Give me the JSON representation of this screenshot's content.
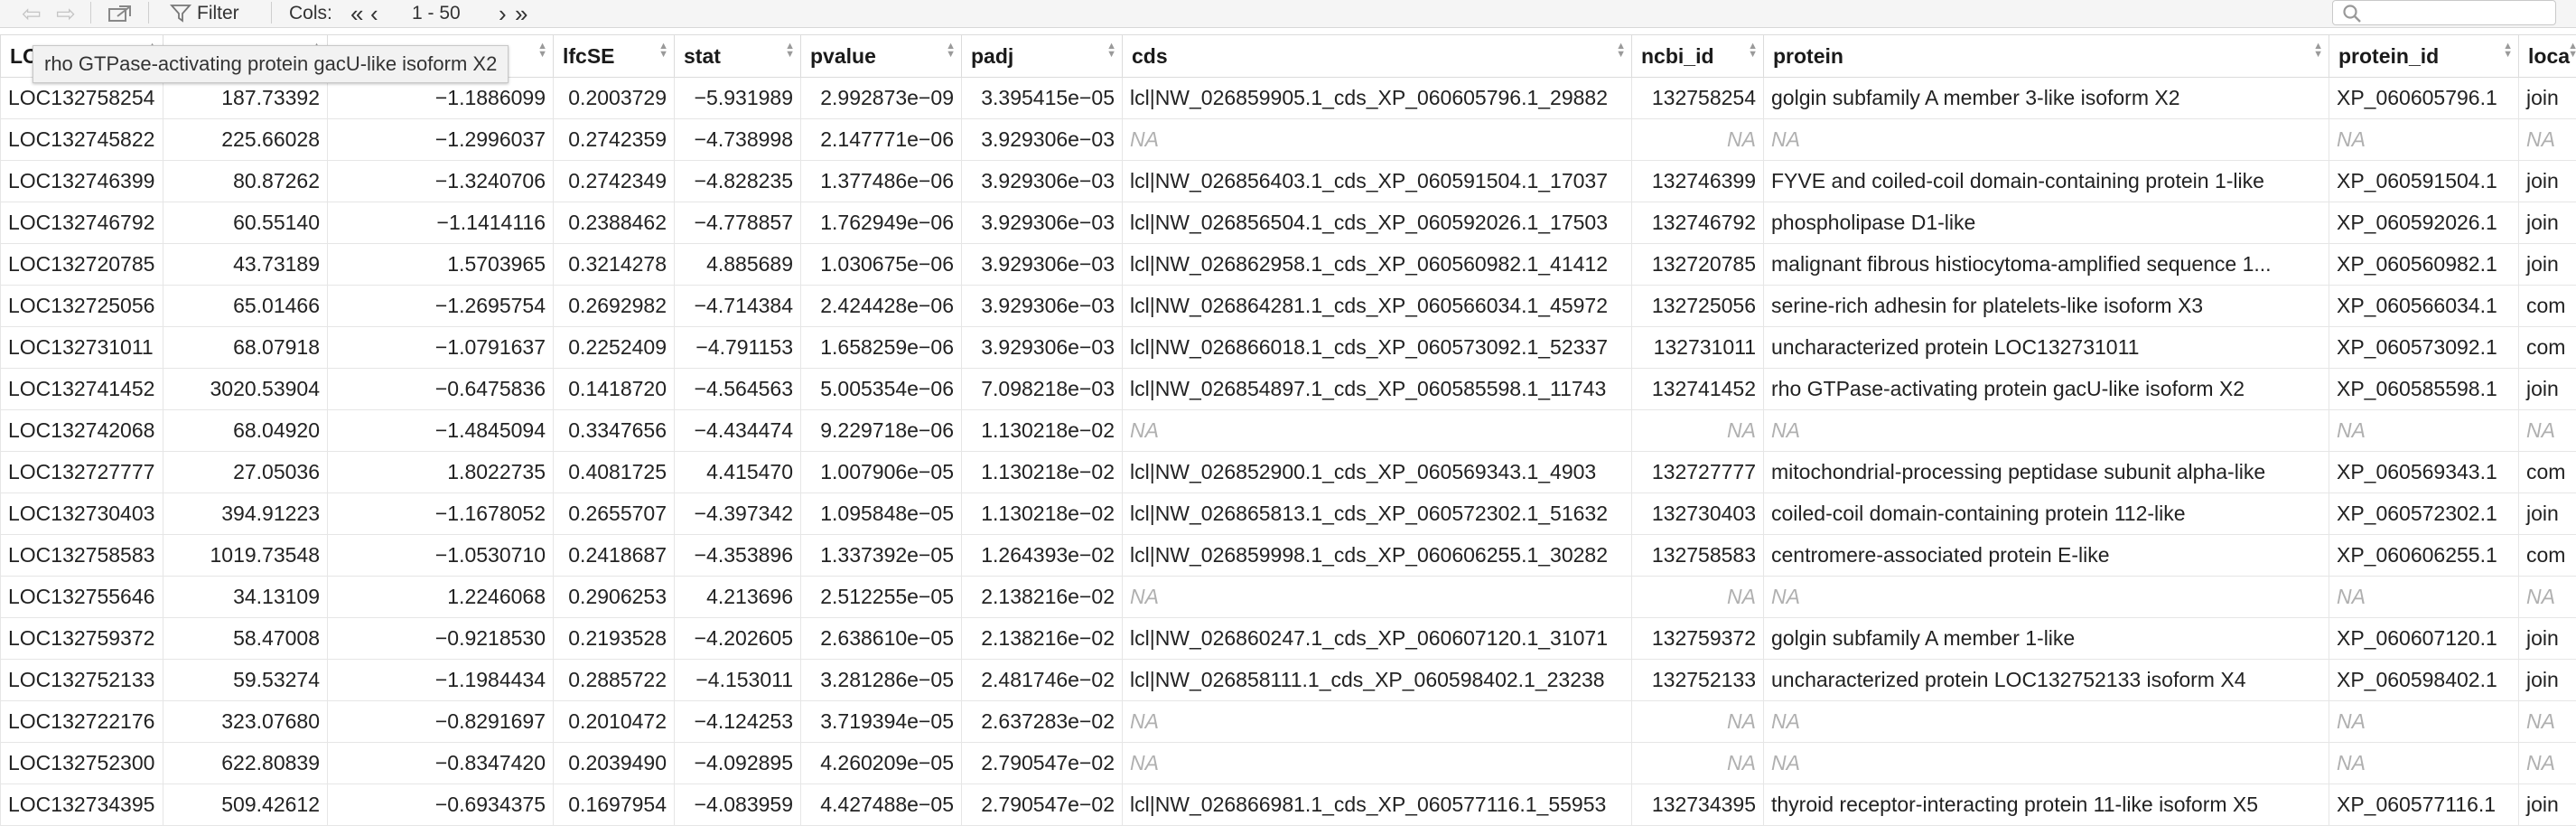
{
  "toolbar": {
    "filter_label": "Filter",
    "cols_label": "Cols:",
    "cols_first": "«",
    "cols_prev": "‹",
    "cols_range": "1 - 50",
    "cols_next": "›",
    "cols_last": "»",
    "search_placeholder": ""
  },
  "tooltip": "rho GTPase-activating protein gacU-like isoform X2",
  "columns": [
    "LO",
    "",
    "",
    "lfcSE",
    "stat",
    "pvalue",
    "padj",
    "cds",
    "ncbi_id",
    "protein",
    "protein_id",
    "loca"
  ],
  "rows": [
    [
      "LOC132758254",
      "187.73392",
      "−1.1886099",
      "0.2003729",
      "−5.931989",
      "2.992873e−09",
      "3.395415e−05",
      "lcl|NW_026859905.1_cds_XP_060605796.1_29882",
      "132758254",
      "golgin subfamily A member 3-like isoform X2",
      "XP_060605796.1",
      "join"
    ],
    [
      "LOC132745822",
      "225.66028",
      "−1.2996037",
      "0.2742359",
      "−4.738998",
      "2.147771e−06",
      "3.929306e−03",
      "NA",
      "NA",
      "NA",
      "NA",
      "NA"
    ],
    [
      "LOC132746399",
      "80.87262",
      "−1.3240706",
      "0.2742349",
      "−4.828235",
      "1.377486e−06",
      "3.929306e−03",
      "lcl|NW_026856403.1_cds_XP_060591504.1_17037",
      "132746399",
      "FYVE and coiled-coil domain-containing protein 1-like",
      "XP_060591504.1",
      "join"
    ],
    [
      "LOC132746792",
      "60.55140",
      "−1.1414116",
      "0.2388462",
      "−4.778857",
      "1.762949e−06",
      "3.929306e−03",
      "lcl|NW_026856504.1_cds_XP_060592026.1_17503",
      "132746792",
      "phospholipase D1-like",
      "XP_060592026.1",
      "join"
    ],
    [
      "LOC132720785",
      "43.73189",
      "1.5703965",
      "0.3214278",
      "4.885689",
      "1.030675e−06",
      "3.929306e−03",
      "lcl|NW_026862958.1_cds_XP_060560982.1_41412",
      "132720785",
      "malignant fibrous histiocytoma-amplified sequence 1...",
      "XP_060560982.1",
      "join"
    ],
    [
      "LOC132725056",
      "65.01466",
      "−1.2695754",
      "0.2692982",
      "−4.714384",
      "2.424428e−06",
      "3.929306e−03",
      "lcl|NW_026864281.1_cds_XP_060566034.1_45972",
      "132725056",
      "serine-rich adhesin for platelets-like isoform X3",
      "XP_060566034.1",
      "com"
    ],
    [
      "LOC132731011",
      "68.07918",
      "−1.0791637",
      "0.2252409",
      "−4.791153",
      "1.658259e−06",
      "3.929306e−03",
      "lcl|NW_026866018.1_cds_XP_060573092.1_52337",
      "132731011",
      "uncharacterized protein LOC132731011",
      "XP_060573092.1",
      "com"
    ],
    [
      "LOC132741452",
      "3020.53904",
      "−0.6475836",
      "0.1418720",
      "−4.564563",
      "5.005354e−06",
      "7.098218e−03",
      "lcl|NW_026854897.1_cds_XP_060585598.1_11743",
      "132741452",
      "rho GTPase-activating protein gacU-like isoform X2",
      "XP_060585598.1",
      "join"
    ],
    [
      "LOC132742068",
      "68.04920",
      "−1.4845094",
      "0.3347656",
      "−4.434474",
      "9.229718e−06",
      "1.130218e−02",
      "NA",
      "NA",
      "NA",
      "NA",
      "NA"
    ],
    [
      "LOC132727777",
      "27.05036",
      "1.8022735",
      "0.4081725",
      "4.415470",
      "1.007906e−05",
      "1.130218e−02",
      "lcl|NW_026852900.1_cds_XP_060569343.1_4903",
      "132727777",
      "mitochondrial-processing peptidase subunit alpha-like",
      "XP_060569343.1",
      "com"
    ],
    [
      "LOC132730403",
      "394.91223",
      "−1.1678052",
      "0.2655707",
      "−4.397342",
      "1.095848e−05",
      "1.130218e−02",
      "lcl|NW_026865813.1_cds_XP_060572302.1_51632",
      "132730403",
      "coiled-coil domain-containing protein 112-like",
      "XP_060572302.1",
      "join"
    ],
    [
      "LOC132758583",
      "1019.73548",
      "−1.0530710",
      "0.2418687",
      "−4.353896",
      "1.337392e−05",
      "1.264393e−02",
      "lcl|NW_026859998.1_cds_XP_060606255.1_30282",
      "132758583",
      "centromere-associated protein E-like",
      "XP_060606255.1",
      "com"
    ],
    [
      "LOC132755646",
      "34.13109",
      "1.2246068",
      "0.2906253",
      "4.213696",
      "2.512255e−05",
      "2.138216e−02",
      "NA",
      "NA",
      "NA",
      "NA",
      "NA"
    ],
    [
      "LOC132759372",
      "58.47008",
      "−0.9218530",
      "0.2193528",
      "−4.202605",
      "2.638610e−05",
      "2.138216e−02",
      "lcl|NW_026860247.1_cds_XP_060607120.1_31071",
      "132759372",
      "golgin subfamily A member 1-like",
      "XP_060607120.1",
      "join"
    ],
    [
      "LOC132752133",
      "59.53274",
      "−1.1984434",
      "0.2885722",
      "−4.153011",
      "3.281286e−05",
      "2.481746e−02",
      "lcl|NW_026858111.1_cds_XP_060598402.1_23238",
      "132752133",
      "uncharacterized protein LOC132752133 isoform X4",
      "XP_060598402.1",
      "join"
    ],
    [
      "LOC132722176",
      "323.07680",
      "−0.8291697",
      "0.2010472",
      "−4.124253",
      "3.719394e−05",
      "2.637283e−02",
      "NA",
      "NA",
      "NA",
      "NA",
      "NA"
    ],
    [
      "LOC132752300",
      "622.80839",
      "−0.8347420",
      "0.2039490",
      "−4.092895",
      "4.260209e−05",
      "2.790547e−02",
      "NA",
      "NA",
      "NA",
      "NA",
      "NA"
    ],
    [
      "LOC132734395",
      "509.42612",
      "−0.6934375",
      "0.1697954",
      "−4.083959",
      "4.427488e−05",
      "2.790547e−02",
      "lcl|NW_026866981.1_cds_XP_060577116.1_55953",
      "132734395",
      "thyroid receptor-interacting protein 11-like isoform X5",
      "XP_060577116.1",
      "join"
    ]
  ]
}
